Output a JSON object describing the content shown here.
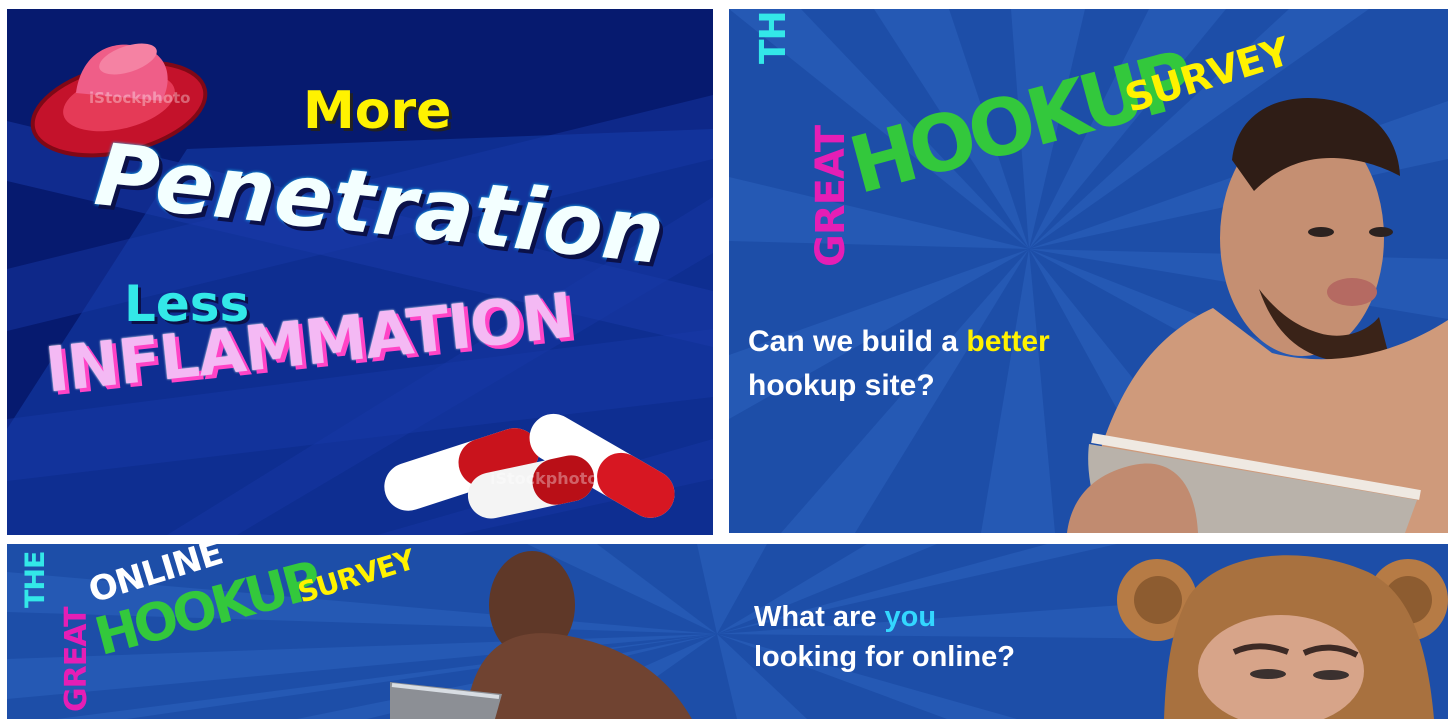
{
  "panels": {
    "top_left": {
      "line_more": "More",
      "line_penetration": "Penetration",
      "line_less": "Less",
      "line_inflammation": "INFLAMMATION",
      "watermark_1": "iStockphoto",
      "watermark_2": "iStockphoto",
      "colors": {
        "background": "#061a6f",
        "more": "#fff200",
        "less": "#33e8e8",
        "inflammation": "#f4b9f4"
      }
    },
    "top_right": {
      "survey_the": "THE",
      "survey_great": "GREAT",
      "survey_hookup": "HOOKUP",
      "survey_word": "SURVEY",
      "question_prefix": "Can we build a ",
      "question_highlight": "better",
      "question_suffix": "hookup site?",
      "colors": {
        "background": "#1d4ea8",
        "the": "#33e8e8",
        "great": "#e51eb5",
        "hookup": "#33c83c",
        "survey": "#fff200",
        "highlight": "#fff200"
      }
    },
    "bottom": {
      "survey_the": "THE",
      "survey_great": "GREAT",
      "survey_online": "ONLINE",
      "survey_hookup": "HOOKUP",
      "survey_word": "SURVEY",
      "question_prefix": "What are ",
      "question_highlight": "you",
      "question_suffix": "looking for online?",
      "colors": {
        "background": "#1d4ea8",
        "the": "#33e8e8",
        "great": "#e51eb5",
        "online": "#ffffff",
        "hookup": "#33c83c",
        "survey": "#fff200",
        "highlight": "#33d7ff"
      }
    }
  }
}
